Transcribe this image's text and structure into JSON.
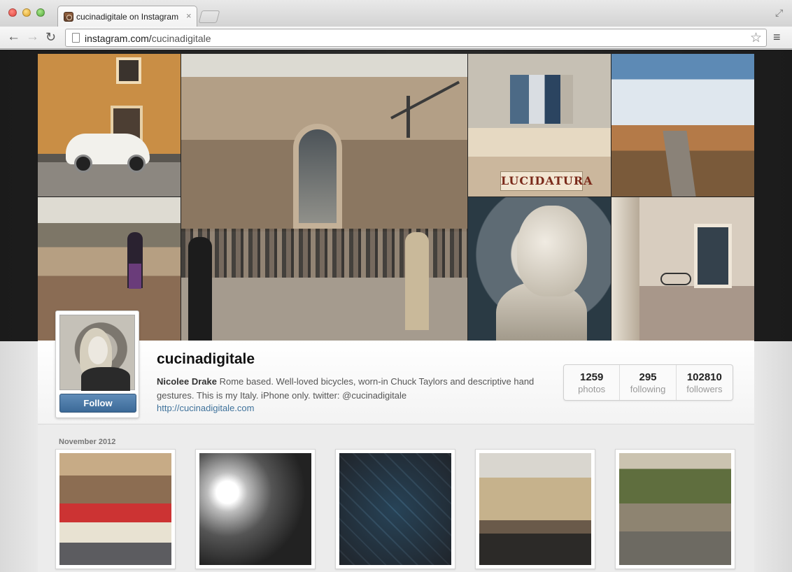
{
  "browser": {
    "tab_title": "cucinadigitale on Instagram",
    "tab_close": "×",
    "url_host": "instagram.com/",
    "url_path": "cucinadigitale",
    "back_icon": "←",
    "forward_icon": "→",
    "reload_icon": "↻",
    "star_icon": "☆",
    "menu_icon": "≡",
    "fullscreen_icon": "⤢"
  },
  "hero": {
    "sign_text": "LUCIDATURA"
  },
  "profile": {
    "username": "cucinadigitale",
    "full_name": "Nicolee Drake",
    "bio": " Rome based. Well-loved bicycles, worn-in Chuck Taylors and descriptive hand gestures. This is my Italy. iPhone only. twitter: @cucinadigitale",
    "website": "http://cucinadigitale.com",
    "follow_label": "Follow",
    "stats": [
      {
        "value": "1259",
        "label": "photos"
      },
      {
        "value": "295",
        "label": "following"
      },
      {
        "value": "102810",
        "label": "followers"
      }
    ]
  },
  "feed": {
    "month_label": "November 2012"
  },
  "colors": {
    "follow_button": "#3c6a98",
    "link": "#3f729b",
    "hero_band": "#1b1b1b"
  }
}
